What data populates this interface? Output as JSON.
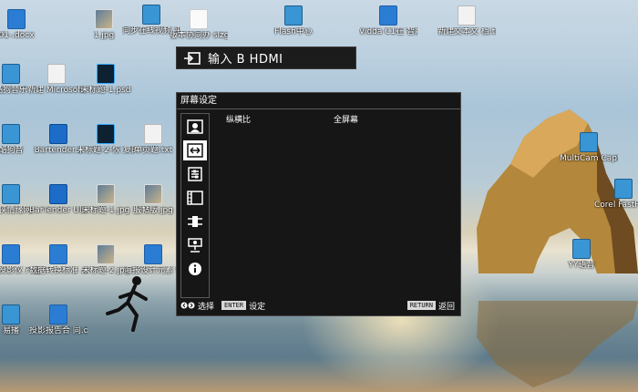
{
  "desktop": {
    "icons": [
      {
        "label": "01-.docx",
        "icon": "word-doc-icon"
      },
      {
        "label": "1.jpg",
        "icon": "image-icon"
      },
      {
        "label": "同步在线视频 平台",
        "icon": "app-icon"
      },
      {
        "label": "版本协同办 slzgrtx",
        "icon": "app-icon"
      },
      {
        "label": "Flash中心",
        "icon": "flash-icon"
      },
      {
        "label": "Vidda C1在 智能投影...",
        "icon": "word-doc-icon"
      },
      {
        "label": "新建文本文 档.txt",
        "icon": "text-file-icon"
      },
      {
        "label": "酷狗音乐",
        "icon": "music-app-icon"
      },
      {
        "label": "新建 Microsoft...",
        "icon": "text-file-icon"
      },
      {
        "label": "未标题-1.psd",
        "icon": "photoshop-icon"
      },
      {
        "label": "酷狗音",
        "icon": "music-app-icon"
      },
      {
        "label": "Bartender...",
        "icon": "bartender-icon"
      },
      {
        "label": "未标题-2-恢 复的.psd",
        "icon": "photoshop-icon"
      },
      {
        "label": "单页题.txt",
        "icon": "text-file-icon"
      },
      {
        "label": "MultiCam Capture 2...",
        "icon": "app-icon"
      },
      {
        "label": "Corel FastFlick",
        "icon": "app-icon"
      },
      {
        "label": "剑侠情缘网",
        "icon": "game-icon"
      },
      {
        "label": "BarTender UltraLite",
        "icon": "bartender-icon"
      },
      {
        "label": "未标题-1.jpg",
        "icon": "image-icon"
      },
      {
        "label": "服帖版.jpg",
        "icon": "image-icon"
      },
      {
        "label": "处理投影仪 产品",
        "icon": "word-doc-icon"
      },
      {
        "label": "数据转换标准 .docx",
        "icon": "word-doc-icon"
      },
      {
        "label": "未标题-2.jpg",
        "icon": "image-icon"
      },
      {
        "label": "海报设计元素 修改.docx",
        "icon": "word-doc-icon"
      },
      {
        "label": "YY语音",
        "icon": "yy-icon"
      },
      {
        "label": "易播",
        "icon": "app-icon"
      },
      {
        "label": "投影报告合 同.docx",
        "icon": "word-doc-icon"
      }
    ]
  },
  "osd": {
    "input_banner": "输入 B HDMI",
    "menu_title": "屏幕设定",
    "tabs": [
      "picture-tab",
      "screen-tab",
      "setup-tab",
      "function-tab",
      "connection-tab",
      "installation-tab",
      "information-tab"
    ],
    "active_tab_index": 1,
    "rows": [
      {
        "key": "纵横比",
        "value": "全屏幕"
      }
    ],
    "footer": {
      "select_label": "选择",
      "enter_key": "ENTER",
      "enter_label": "设定",
      "return_key": "RETURN",
      "return_label": "返回"
    }
  }
}
